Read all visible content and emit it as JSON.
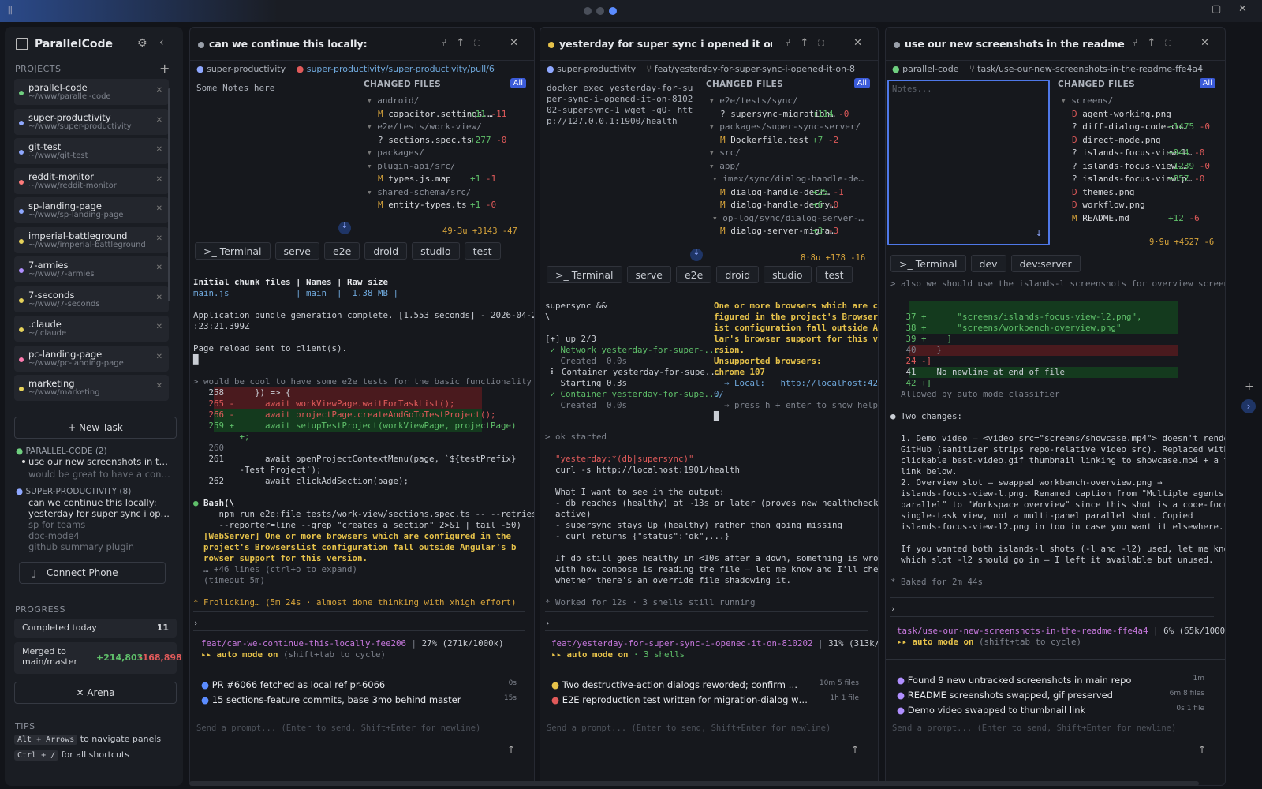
{
  "app": {
    "name": "ParallelCode"
  },
  "sidebar": {
    "projects_title": "PROJECTS",
    "projects": [
      {
        "name": "parallel-code",
        "path": "~/www/parallel-code",
        "color": "#6fcf7f"
      },
      {
        "name": "super-productivity",
        "path": "~/www/super-productivity",
        "color": "#8fa8ff"
      },
      {
        "name": "git-test",
        "path": "~/www/git-test",
        "color": "#8fa8ff"
      },
      {
        "name": "reddit-monitor",
        "path": "~/www/reddit-monitor",
        "color": "#ff7b7b"
      },
      {
        "name": "sp-landing-page",
        "path": "~/www/sp-landing-page",
        "color": "#8fa8ff"
      },
      {
        "name": "imperial-battleground",
        "path": "~/www/imperial-battleground",
        "color": "#e6d25a"
      },
      {
        "name": "7-armies",
        "path": "~/www/7-armies",
        "color": "#b08fff"
      },
      {
        "name": "7-seconds",
        "path": "~/www/7-seconds",
        "color": "#e6d25a"
      },
      {
        "name": ".claude",
        "path": "~/.claude",
        "color": "#e6d25a"
      },
      {
        "name": "pc-landing-page",
        "path": "~/www/pc-landing-page",
        "color": "#ff7bb0"
      },
      {
        "name": "marketing",
        "path": "~/www/marketing",
        "color": "#e6d25a"
      }
    ],
    "new_task": "New Task",
    "groups": [
      {
        "title": "PARALLEL-CODE (2)",
        "tasks": [
          "use our new screenshots in t…",
          "would be great to have a con…"
        ]
      },
      {
        "title": "SUPER-PRODUCTIVITY (8)",
        "tasks": [
          "can we continue this locally:",
          "yesterday for super sync i op…",
          "sp for teams",
          "doc-mode4",
          "github summary plugin"
        ]
      }
    ],
    "connect_phone": "Connect Phone",
    "progress_title": "PROGRESS",
    "completed_label": "Completed today",
    "completed_value": "11",
    "merged_label": "Merged to main/master",
    "merged_add": "+214,803",
    "merged_del": "-168,898",
    "arena": "Arena",
    "tips_title": "TIPS",
    "tip1_key": "Alt + Arrows",
    "tip1": "to navigate panels",
    "tip2_key": "Ctrl + /",
    "tip2": "for all shortcuts"
  },
  "panels": [
    {
      "title": "can we continue this locally:",
      "repo": "super-productivity",
      "branch": "super-productivity/super-productivity/pull/6",
      "notes": "Some Notes here",
      "changed_title": "CHANGED FILES",
      "all": "All",
      "files": [
        {
          "n": "android/",
          "s": "",
          "a": "",
          "d": ""
        },
        {
          "n": "capacitor.settings.…",
          "s": "M",
          "a": "+11",
          "d": "-11"
        },
        {
          "n": "e2e/tests/work-view/",
          "s": "",
          "a": "",
          "d": ""
        },
        {
          "n": "sections.spec.ts",
          "s": "?",
          "a": "+277",
          "d": "-0"
        },
        {
          "n": "packages/",
          "s": "",
          "a": "",
          "d": ""
        },
        {
          "n": "plugin-api/src/",
          "s": "",
          "a": "",
          "d": ""
        },
        {
          "n": "types.js.map",
          "s": "M",
          "a": "+1",
          "d": "-1"
        },
        {
          "n": "shared-schema/src/",
          "s": "",
          "a": "",
          "d": ""
        },
        {
          "n": "entity-types.ts",
          "s": "M",
          "a": "+1",
          "d": "-0"
        }
      ],
      "summary": "49·3u +3143 -47",
      "tabs": [
        ">_ Terminal",
        "serve",
        "e2e",
        "droid",
        "studio",
        "test"
      ],
      "status_branch": "feat/can-we-continue-this-locally-fee206",
      "status_ctx": "27% (271k/1000k)",
      "auto_mode": "auto mode on",
      "auto_hint": "(shift+tab to cycle)",
      "bottom": [
        {
          "t": "PR #6066 fetched as local ref pr-6066",
          "time": "0s"
        },
        {
          "t": "15 sections-feature commits, base 3mo behind master",
          "time": "15s"
        }
      ],
      "prompt": "Send a prompt... (Enter to send, Shift+Enter for newline)"
    },
    {
      "title": "yesterday for super sync i opened it on a dev…",
      "repo": "super-productivity",
      "branch": "feat/yesterday-for-super-sync-i-opened-it-on-8",
      "notes": "docker exec yesterday-for-super-sync-i-opened-it-on-810202-supersync-1 wget -qO- http://127.0.0.1:1900/health",
      "changed_title": "CHANGED FILES",
      "all": "All",
      "files": [
        {
          "n": "e2e/tests/sync/",
          "s": "",
          "a": "",
          "d": ""
        },
        {
          "n": "supersync-migration…",
          "s": "?",
          "a": "+114",
          "d": "-0"
        },
        {
          "n": "packages/super-sync-server/",
          "s": "",
          "a": "",
          "d": ""
        },
        {
          "n": "Dockerfile.test",
          "s": "M",
          "a": "+7",
          "d": "-2"
        },
        {
          "n": "src/",
          "s": "",
          "a": "",
          "d": ""
        },
        {
          "n": "app/",
          "s": "",
          "a": "",
          "d": ""
        },
        {
          "n": "imex/sync/dialog-handle-de…",
          "s": "",
          "a": "",
          "d": ""
        },
        {
          "n": "dialog-handle-decr…",
          "s": "M",
          "a": "+25",
          "d": "-1"
        },
        {
          "n": "dialog-handle-decry…",
          "s": "M",
          "a": "+6",
          "d": "-0"
        },
        {
          "n": "op-log/sync/dialog-server-…",
          "s": "",
          "a": "",
          "d": ""
        },
        {
          "n": "dialog-server-migra…",
          "s": "M",
          "a": "+3",
          "d": "-3"
        }
      ],
      "summary": "8·8u +178 -16",
      "tabs": [
        ">_ Terminal",
        "serve",
        "e2e",
        "droid",
        "studio",
        "test"
      ],
      "status_branch": "feat/yesterday-for-super-sync-i-opened-it-on-810202",
      "status_ctx": "31% (313k/10…",
      "auto_mode": "auto mode on",
      "auto_hint": "· 3 shells",
      "bottom": [
        {
          "t": "Two destructive-action dialogs reworded; confirm …",
          "time": "10m",
          "files": "5 files"
        },
        {
          "t": "E2E reproduction test written for migration-dialog w…",
          "time": "1h",
          "files": "1 file"
        }
      ],
      "prompt": "Send a prompt... (Enter to send, Shift+Enter for newline)"
    },
    {
      "title": "use our new screenshots in the readme (rath…",
      "repo": "parallel-code",
      "branch": "task/use-our-new-screenshots-in-the-readme-ffe4a4",
      "notes_placeholder": "Notes...",
      "changed_title": "CHANGED FILES",
      "all": "All",
      "files": [
        {
          "n": "screens/",
          "s": "",
          "a": "",
          "d": ""
        },
        {
          "n": "agent-working.png",
          "s": "D",
          "a": "",
          "d": ""
        },
        {
          "n": "diff-dialog-code-co…",
          "s": "?",
          "a": "+1475",
          "d": "-0"
        },
        {
          "n": "direct-mode.png",
          "s": "D",
          "a": "",
          "d": ""
        },
        {
          "n": "islands-focus-view-l…",
          "s": "?",
          "a": "+944",
          "d": "-0"
        },
        {
          "n": "islands-focus-view-…",
          "s": "?",
          "a": "+1239",
          "d": "-0"
        },
        {
          "n": "islands-focus-view.p…",
          "s": "?",
          "a": "+857",
          "d": "-0"
        },
        {
          "n": "themes.png",
          "s": "D",
          "a": "",
          "d": ""
        },
        {
          "n": "workflow.png",
          "s": "D",
          "a": "",
          "d": ""
        },
        {
          "n": "README.md",
          "s": "M",
          "a": "+12",
          "d": "-6"
        }
      ],
      "summary": "9·9u +4527 -6",
      "tabs": [
        ">_ Terminal",
        "dev",
        "dev:server"
      ],
      "status_branch": "task/use-our-new-screenshots-in-the-readme-ffe4a4",
      "status_ctx": "6% (65k/1000k)",
      "auto_mode": "auto mode on",
      "auto_hint": "(shift+tab to cycle)",
      "bottom": [
        {
          "t": "Found 9 new untracked screenshots in main repo",
          "time": "1m"
        },
        {
          "t": "README screenshots swapped, gif preserved",
          "time": "6m",
          "files": "8 files"
        },
        {
          "t": "Demo video swapped to thumbnail link",
          "time": "0s",
          "files": "1 file"
        }
      ],
      "prompt": "Send a prompt... (Enter to send, Shift+Enter for newline)"
    }
  ],
  "term1": {
    "header": "Initial chunk files | Names | Raw size",
    "row": "main.js             | main  |  1.38 MB |",
    "l1": "Application bundle generation complete. [1.553 seconds] - 2026-04-28T12",
    "l2": ":23:21.399Z",
    "l3": "Page reload sent to client(s).",
    "user": "> would be cool to have some e2e tests for the basic functionality",
    "d1": "   258      }) => {",
    "d2": "   265 -      await workViewPage.waitForTaskList();",
    "d3": "   266 -      await projectPage.createAndGoToTestProject();",
    "d4": "   259 +      await setupTestProject(workViewPage, projectPage)",
    "d4b": "         +;",
    "d5": "   260",
    "d6": "   261        await openProjectContextMenu(page, `${testPrefix}",
    "d6b": "         -Test Project`);",
    "d7": "   262        await clickAddSection(page);",
    "bash": "Bash(\\",
    "b1": "     npm run e2e:file tests/work-view/sections.spec.ts -- --retries=0",
    "b2": "     --reporter=line --grep \"creates a section\" 2>&1 | tail -50)",
    "b3": "  [WebServer] One or more browsers which are configured in the",
    "b4": "  project's Browserslist configuration fall outside Angular's b",
    "b5": "  rowser support for this version.",
    "b6": "  … +46 lines (ctrl+o to expand)",
    "b7": "  (timeout 5m)",
    "frolic": "* Frolicking… (5m 24s · almost done thinking with xhigh effort)"
  },
  "term2": {
    "l1": "supersync &&",
    "l2": "\\",
    "l3": "[+] up 2/3",
    "l4": " ✓ Network yesterday-for-super-...",
    "l5": "   Created  0.0s",
    "l6": " ⠇ Container yesterday-for-supe...",
    "l7": "   Starting 0.3s",
    "l8": " ✓ Container yesterday-for-supe...",
    "l9": "   Created  0.0s",
    "r1": "One or more browsers which are con",
    "r2": "figured in the project's Browsersl",
    "r3": "ist configuration fall outside Angu",
    "r4": "lar's browser support for this ve",
    "r5": "rsion.",
    "r6": "Unsupported browsers:",
    "r7": "chrome 107",
    "r8": "  → Local:   http://localhost:420",
    "r9": "0/",
    "r10": "  → press h + enter to show help",
    "user": "> ok started",
    "s1": "  \"yesterday:*(db|supersync)\"",
    "s2": "  curl -s http://localhost:1901/health",
    "s3": "  What I want to see in the output:",
    "s4": "  - db reaches (healthy) at ~13s or later (proves new healthcheck",
    "s5": "  active)",
    "s6": "  - supersync stays Up (healthy) rather than going missing",
    "s7": "  - curl returns {\"status\":\"ok\",...}",
    "s8": "  If db still goes healthy in <10s after a down, something is wrong",
    "s9": "  with how compose is reading the file — let me know and I'll check",
    "s10": "  whether there's an override file shadowing it.",
    "worked": "* Worked for 12s · 3 shells still running"
  },
  "term3": {
    "user": "> also we should use the islands-l screenshots for overview screenshot",
    "d1": "   37 +      \"screens/islands-focus-view-l2.png\",",
    "d2": "   38 +      \"screens/workbench-overview.png\"",
    "d3": "   39 +    ]",
    "d4": "   40    }",
    "d5": "   24 -]",
    "d6": "   41    No newline at end of file",
    "d7": "   42 +]",
    "allowed": "  Allowed by auto mode classifier",
    "two": "● Two changes:",
    "p1": "  1. Demo video — <video src=\"screens/showcase.mp4\"> doesn't render on",
    "p2": "  GitHub (sanitizer strips repo-relative video src). Replaced with a",
    "p3": "  clickable best-video.gif thumbnail linking to showcase.mp4 + a text",
    "p4": "  link below.",
    "p5": "  2. Overview slot — swapped workbench-overview.png →",
    "p6": "  islands-focus-view-l.png. Renamed caption from \"Multiple agents in",
    "p7": "  parallel\" to \"Workspace overview\" since this shot is a code-focused",
    "p8": "  single-task view, not a multi-panel parallel shot. Copied",
    "p9": "  islands-focus-view-l2.png in too in case you want it elsewhere.",
    "q1": "  If you wanted both islands-l shots (-l and -l2) used, let me know",
    "q2": "  which slot -l2 should go in — I left it available but unused.",
    "baked": "* Baked for 2m 44s"
  }
}
